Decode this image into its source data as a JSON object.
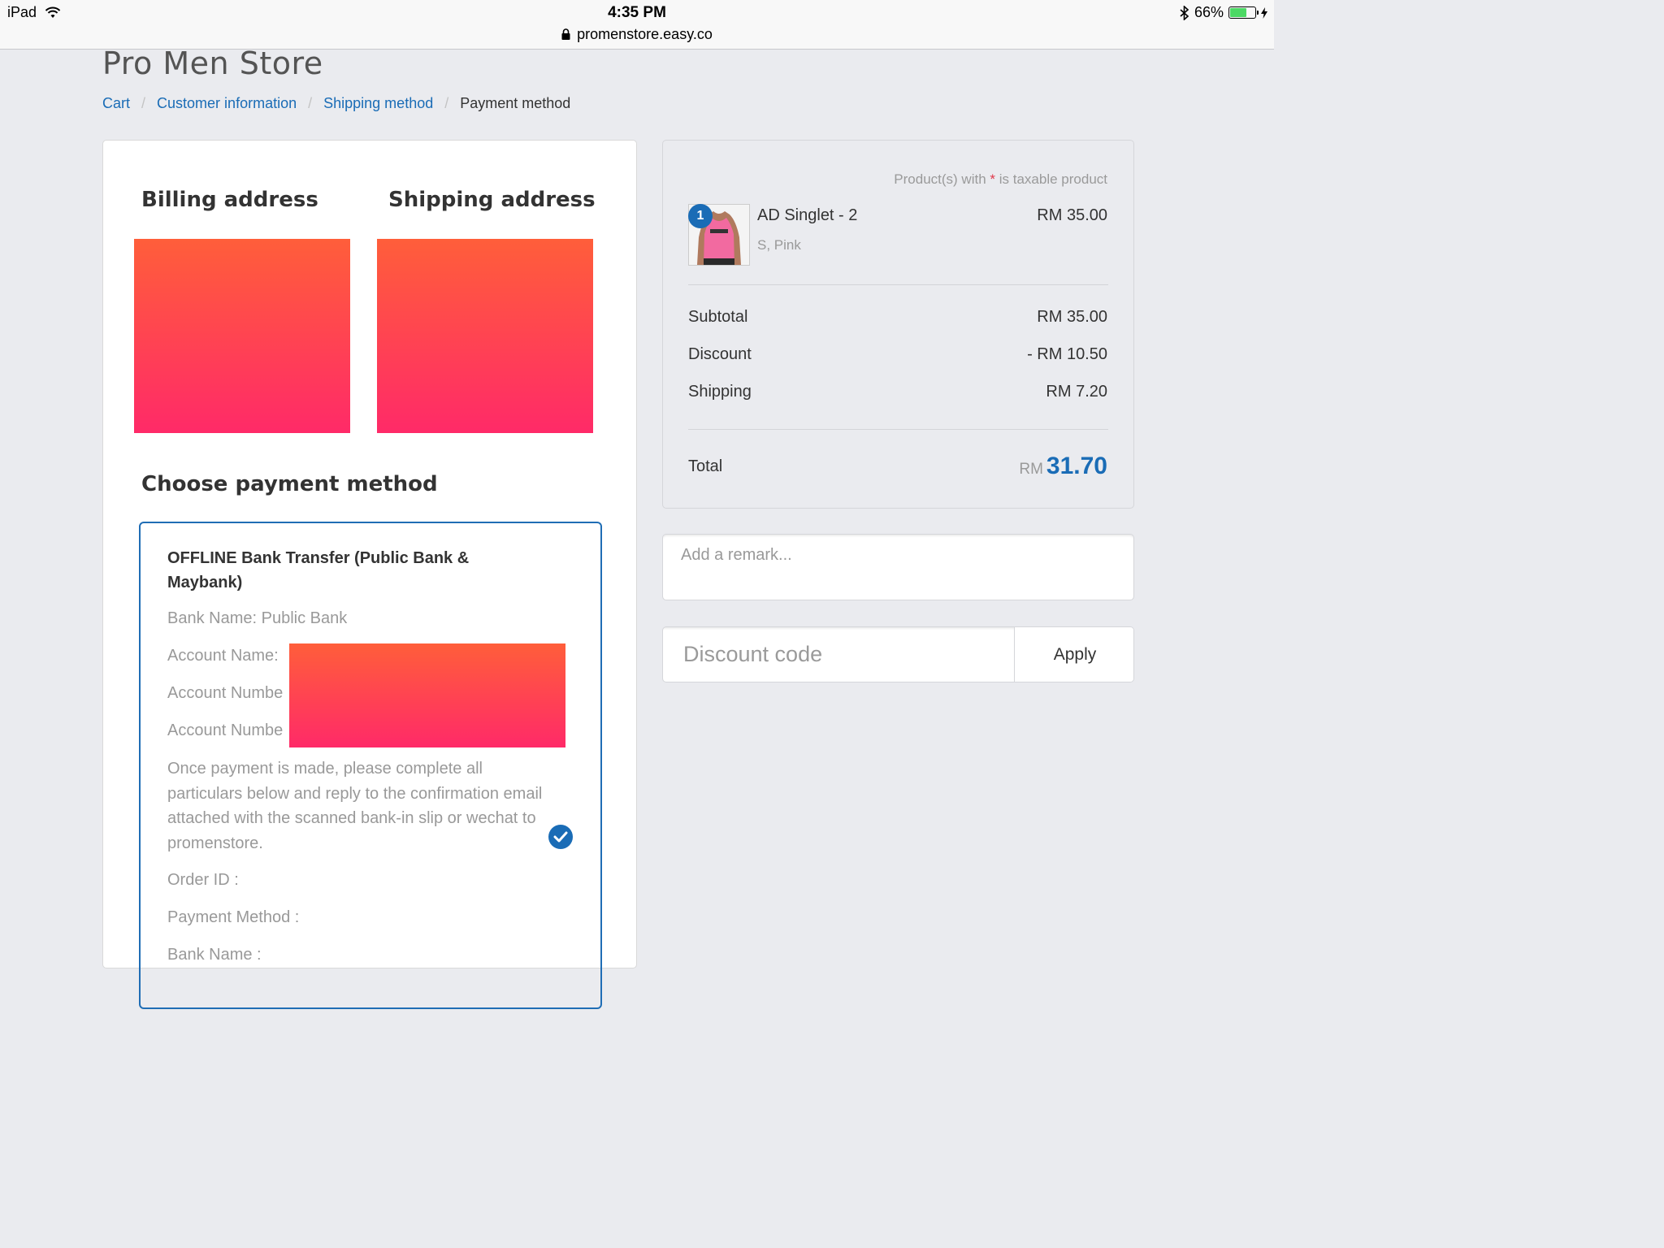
{
  "status_bar": {
    "device": "iPad",
    "time": "4:35 PM",
    "url": "promenstore.easy.co",
    "battery": "66%",
    "battery_level": 0.66
  },
  "store": {
    "title": "Pro Men Store"
  },
  "breadcrumb": {
    "items": [
      "Cart",
      "Customer information",
      "Shipping method"
    ],
    "current": "Payment method",
    "separator": "/"
  },
  "addresses": {
    "billing_heading": "Billing address",
    "shipping_heading": "Shipping address"
  },
  "payment": {
    "heading": "Choose payment method",
    "method_title": "OFFLINE Bank Transfer (Public Bank & Maybank)",
    "lines": [
      "Bank Name: Public Bank",
      "Account Name:",
      "Account Numbe",
      "Account Numbe"
    ],
    "description": "Once payment is made, please complete all particulars below and reply to the confirmation email attached with the scanned bank-in slip or wechat to promenstore.",
    "order_id": "Order ID :",
    "payment_method": "Payment Method :",
    "bank_name": "Bank Name :"
  },
  "summary": {
    "tax_note_prefix": "Product(s) with",
    "tax_note_star": "*",
    "tax_note_suffix": "is taxable product",
    "product": {
      "quantity": "1",
      "name": "AD Singlet - 2",
      "variant": "S, Pink",
      "price": "RM 35.00"
    },
    "rows": [
      {
        "label": "Subtotal",
        "value": "RM 35.00"
      },
      {
        "label": "Discount",
        "value": "- RM 10.50"
      },
      {
        "label": "Shipping",
        "value": "RM 7.20"
      }
    ],
    "total_label": "Total",
    "total_currency": "RM",
    "total_value": "31.70"
  },
  "remark": {
    "placeholder": "Add a remark..."
  },
  "discount": {
    "placeholder": "Discount code",
    "apply_label": "Apply"
  },
  "colors": {
    "accent": "#1a6cb6",
    "redaction_top": "#ff5e3a",
    "redaction_bottom": "#ff2a68"
  }
}
